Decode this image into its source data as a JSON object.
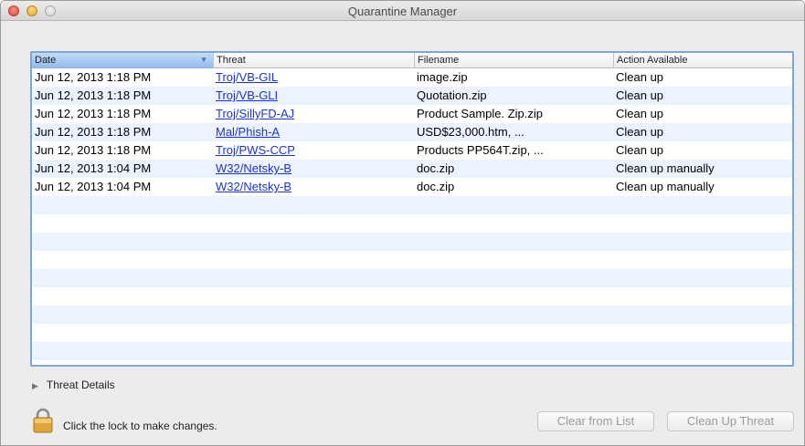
{
  "window": {
    "title": "Quarantine Manager"
  },
  "table": {
    "columns": {
      "date": "Date",
      "threat": "Threat",
      "filename": "Filename",
      "action": "Action Available"
    },
    "sorted_column": "date",
    "rows": [
      {
        "date": "Jun 12, 2013 1:18 PM",
        "threat": "Troj/VB-GIL",
        "filename": "image.zip",
        "action": "Clean up"
      },
      {
        "date": "Jun 12, 2013 1:18 PM",
        "threat": "Troj/VB-GLI",
        "filename": "Quotation.zip",
        "action": "Clean up"
      },
      {
        "date": "Jun 12, 2013 1:18 PM",
        "threat": "Troj/SillyFD-AJ",
        "filename": "Product Sample. Zip.zip",
        "action": "Clean up"
      },
      {
        "date": "Jun 12, 2013 1:18 PM",
        "threat": "Mal/Phish-A",
        "filename": "USD$23,000.htm, ...",
        "action": "Clean up"
      },
      {
        "date": "Jun 12, 2013 1:18 PM",
        "threat": "Troj/PWS-CCP",
        "filename": "Products PP564T.zip, ...",
        "action": "Clean up"
      },
      {
        "date": "Jun 12, 2013 1:04 PM",
        "threat": "W32/Netsky-B",
        "filename": "doc.zip",
        "action": "Clean up manually"
      },
      {
        "date": "Jun 12, 2013 1:04 PM",
        "threat": "W32/Netsky-B",
        "filename": "doc.zip",
        "action": "Clean up manually"
      }
    ]
  },
  "details": {
    "label": "Threat Details"
  },
  "footer": {
    "lock_text": "Click the lock to make changes.",
    "clear_button": "Clear from List",
    "cleanup_button": "Clean Up Threat"
  },
  "icons": {
    "close": "close-icon",
    "minimize": "minimize-icon",
    "maximize": "maximize-icon",
    "sort": "sort-descending-icon",
    "disclosure": "disclosure-triangle-icon",
    "lock": "lock-icon"
  },
  "colors": {
    "link": "#1a33cc",
    "selection_border": "#7aa7d9",
    "alt_row": "#edf3fe"
  }
}
